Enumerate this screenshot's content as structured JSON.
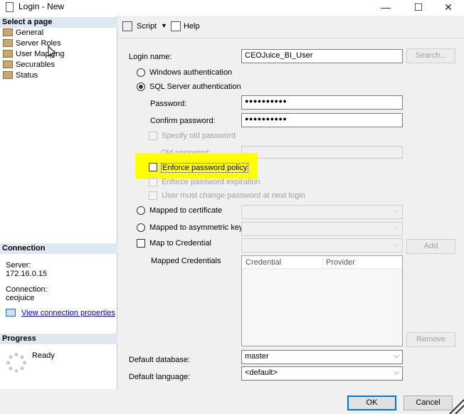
{
  "window": {
    "title": "Login - New",
    "minimize": "—",
    "maximize": "☐",
    "close": "✕"
  },
  "left": {
    "select_page_header": "Select a page",
    "pages": [
      "General",
      "Server Roles",
      "User Mapping",
      "Securables",
      "Status"
    ],
    "connection_header": "Connection",
    "server_label": "Server:",
    "server_value": "172.16.0.15",
    "connection_label": "Connection:",
    "connection_value": "ceojuice",
    "view_connection_link": "View connection properties",
    "progress_header": "Progress",
    "progress_status": "Ready"
  },
  "toolbar": {
    "script": "Script",
    "help": "Help"
  },
  "form": {
    "login_name_label": "Login name:",
    "login_name_value": "CEOJuice_BI_User",
    "search_button": "Search...",
    "windows_auth": "Windows authentication",
    "sql_auth": "SQL Server authentication",
    "password_label": "Password:",
    "password_value": "●●●●●●●●●●",
    "confirm_password_label": "Confirm password:",
    "confirm_password_value": "●●●●●●●●●●",
    "specify_old_password": "Specify old password",
    "old_password_label": "Old password:",
    "enforce_policy": "Enforce password policy",
    "enforce_expiration": "Enforce password expiration",
    "must_change": "User must change password at next login",
    "mapped_certificate": "Mapped to certificate",
    "mapped_asym_key": "Mapped to asymmetric key",
    "map_credential": "Map to Credential",
    "add_button": "Add",
    "mapped_credentials_label": "Mapped Credentials",
    "cred_columns": [
      "Credential",
      "Provider"
    ],
    "remove_button": "Remove",
    "default_db_label": "Default database:",
    "default_db_value": "master",
    "default_lang_label": "Default language:",
    "default_lang_value": "<default>"
  },
  "footer": {
    "ok": "OK",
    "cancel": "Cancel"
  },
  "colors": {
    "highlight": "#ffff00",
    "section_header": "#dfe7f1",
    "link": "#0000ee"
  }
}
